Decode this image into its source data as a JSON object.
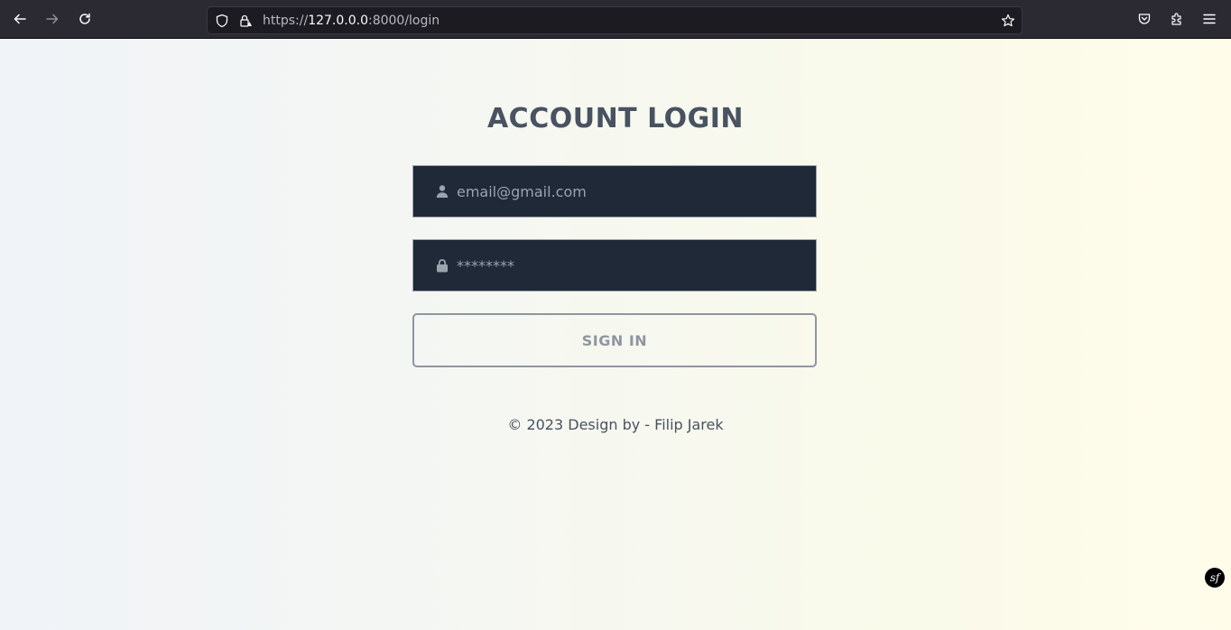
{
  "browser": {
    "url_scheme": "https://",
    "url_host": "127.0.0.0",
    "url_rest": ":8000/login"
  },
  "login": {
    "title": "ACCOUNT LOGIN",
    "email_placeholder": "email@gmail.com",
    "password_placeholder": "********",
    "sign_in_label": "SIGN IN"
  },
  "footer": {
    "text": "© 2023 Design by - Filip Jarek"
  },
  "badge": {
    "symfony_logo_text": "sf"
  },
  "colors": {
    "field_bg": "#1f2937",
    "title": "#485260",
    "button_border": "#8f96a0"
  }
}
